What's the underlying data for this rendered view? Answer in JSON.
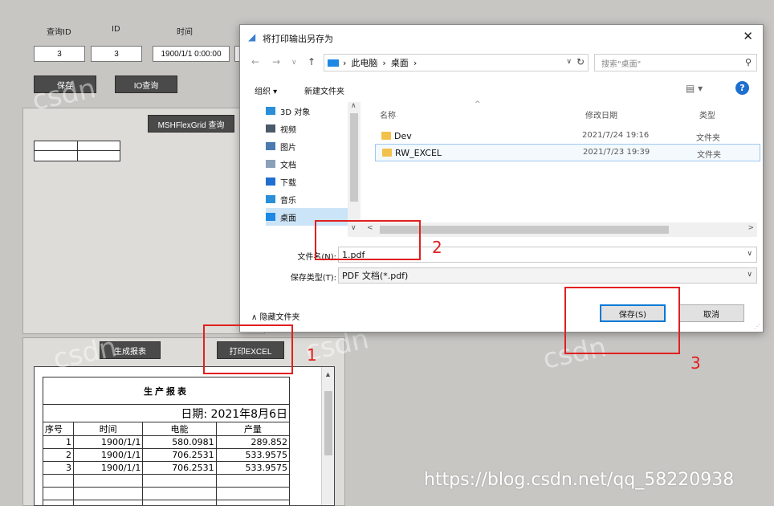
{
  "app": {
    "labels": {
      "query_id": "查询ID",
      "id": "ID",
      "time": "时间"
    },
    "inputs": {
      "query_id": "3",
      "id": "3",
      "time": "1900/1/1 0:00:00"
    },
    "buttons": {
      "save": "保存",
      "io_query": "IO查询",
      "flexgrid_query": "MSHFlexGrid 查询",
      "generate_report": "生成报表",
      "print_excel": "打印EXCEL"
    }
  },
  "report": {
    "title": "生产报表",
    "date": "日期: 2021年8月6日",
    "headers": [
      "序号",
      "时间",
      "电能",
      "产量"
    ],
    "rows": [
      [
        "1",
        "1900/1/1",
        "580.0981",
        "289.852"
      ],
      [
        "2",
        "1900/1/1",
        "706.2531",
        "533.9575"
      ],
      [
        "3",
        "1900/1/1",
        "706.2531",
        "533.9575"
      ]
    ],
    "scroll_up_icon": "chevron-up-icon"
  },
  "dialog": {
    "title": "将打印输出另存为",
    "close": "✕",
    "nav": {
      "back": "←",
      "forward": "→",
      "recent": "∨",
      "up": "↑"
    },
    "breadcrumb": [
      "此电脑",
      "桌面"
    ],
    "search_placeholder": "搜索\"桌面\"",
    "organize": "组织 ▾",
    "new_folder": "新建文件夹",
    "view_icon": "▤ ▾",
    "help": "?",
    "tree": [
      {
        "label": "3D 对象",
        "icon": "cube-icon",
        "color": "#2a8fd8"
      },
      {
        "label": "视频",
        "icon": "video-icon",
        "color": "#4a5a6a"
      },
      {
        "label": "图片",
        "icon": "picture-icon",
        "color": "#4a7ab0"
      },
      {
        "label": "文档",
        "icon": "document-icon",
        "color": "#8aa0b8"
      },
      {
        "label": "下载",
        "icon": "download-icon",
        "color": "#1e6fd0"
      },
      {
        "label": "音乐",
        "icon": "music-icon",
        "color": "#2a8fd8"
      },
      {
        "label": "桌面",
        "icon": "desktop-icon",
        "color": "#1e88e5"
      }
    ],
    "columns": {
      "name": "名称",
      "date": "修改日期",
      "type": "类型"
    },
    "files": [
      {
        "name": "Dev",
        "date": "2021/7/24 19:16",
        "type": "文件夹"
      },
      {
        "name": "RW_EXCEL",
        "date": "2021/7/23 19:39",
        "type": "文件夹"
      }
    ],
    "filename_label": "文件名(N):",
    "filename": "1.pdf",
    "filetype_label": "保存类型(T):",
    "filetype": "PDF 文档(*.pdf)",
    "hide_folders": "∧ 隐藏文件夹",
    "save": "保存(S)",
    "cancel": "取消"
  },
  "annotations": {
    "n1": "1",
    "n2": "2",
    "n3": "3",
    "color": "#e02020"
  },
  "watermarks": [
    "csdn",
    "csdn",
    "csdn",
    "csdn",
    "csdn",
    "csdn"
  ],
  "url_watermark": "https://blog.csdn.net/qq_58220938"
}
